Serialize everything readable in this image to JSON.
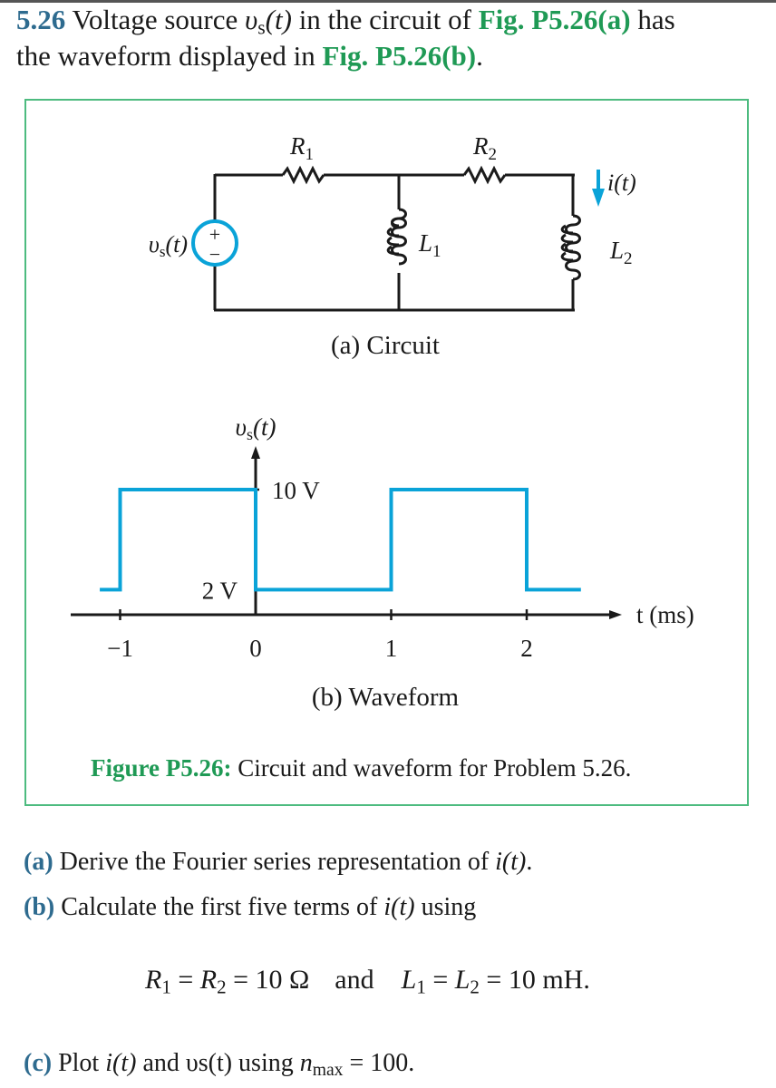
{
  "problem": {
    "number": "5.26",
    "intro_1": " Voltage source ",
    "vs_symbol": "υ",
    "vs_sub": "s",
    "vs_arg": "(t)",
    "intro_2": " in the circuit of ",
    "fig_a_ref": "Fig. P5.26(a)",
    "intro_3": " has",
    "line2_1": "the waveform displayed in ",
    "fig_b_ref": "Fig. P5.26(b)",
    "line2_2": "."
  },
  "figure": {
    "circuit": {
      "R1_label": "R",
      "R1_sub": "1",
      "R2_label": "R",
      "R2_sub": "2",
      "L1_label": "L",
      "L1_sub": "1",
      "L2_label": "L",
      "L2_sub": "2",
      "source_label": "υ",
      "source_sub": "s",
      "source_arg": "(t)",
      "plus": "+",
      "minus": "−",
      "current_label": "i(t)",
      "caption": "(a) Circuit",
      "accent_color": "#0aa3d8"
    },
    "waveform_caption": "(b) Waveform",
    "caption_bold": "Figure P5.26:",
    "caption_text": " Circuit and waveform for Problem 5.26."
  },
  "chart_data": {
    "type": "line",
    "title": "(b) Waveform",
    "xlabel": "t (ms)",
    "ylabel": "υs(t)",
    "x_ticks": [
      -1,
      0,
      1,
      2
    ],
    "x_tick_labels": [
      "−1",
      "0",
      "1",
      "2"
    ],
    "y_ticks": [
      2,
      10
    ],
    "y_tick_labels": [
      "2 V",
      "10 V"
    ],
    "xlim": [
      -1.5,
      2.6
    ],
    "ylim": [
      0,
      14
    ],
    "grid": false,
    "series": [
      {
        "name": "υs(t)",
        "color": "#0aa3d8",
        "x": [
          -1.15,
          -1,
          -1,
          0,
          0,
          1,
          1,
          2,
          2,
          2.4
        ],
        "y": [
          2,
          2,
          10,
          10,
          2,
          2,
          10,
          10,
          2,
          2
        ]
      }
    ]
  },
  "questions": [
    {
      "label": "(a)",
      "text_1": " Derive the Fourier series representation of ",
      "var": "i",
      "arg": "(t)",
      "text_2": "."
    },
    {
      "label": "(b)",
      "text_1": " Calculate the first five terms of ",
      "var": "i",
      "arg": "(t)",
      "text_2": " using"
    },
    {
      "label": "(c)",
      "text_1": " Plot ",
      "var": "i",
      "arg": "(t)",
      "text_2": " and υs(t) using ",
      "nmax_var": "n",
      "nmax_sub": "max",
      "nmax_val": " = 100."
    }
  ],
  "equation": {
    "R1": "R",
    "R1_sub": "1",
    "eq1": " = ",
    "R2": "R",
    "R2_sub": "2",
    "rval": " = 10 Ω",
    "and": "and",
    "L1": "L",
    "L1_sub": "1",
    "eq2": " = ",
    "L2": "L",
    "L2_sub": "2",
    "lval": " = 10 mH."
  }
}
